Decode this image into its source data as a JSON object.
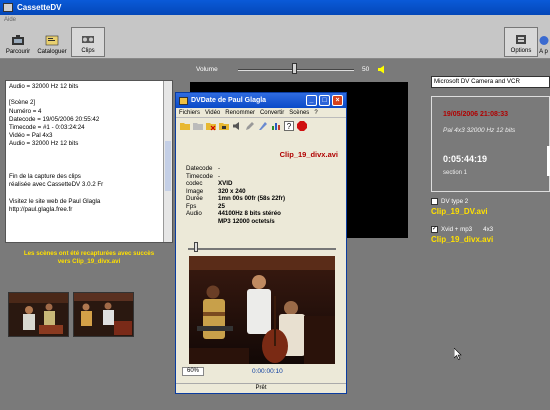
{
  "app": {
    "title": "CassetteDV",
    "menu_item": "Aide"
  },
  "toolbar": {
    "buttons": [
      {
        "label": "Parcourir",
        "icon": "browse-icon"
      },
      {
        "label": "Cataloguer",
        "icon": "catalog-icon"
      },
      {
        "label": "Clips",
        "icon": "clips-icon",
        "active": true
      },
      {
        "label": "Options",
        "icon": "options-icon"
      },
      {
        "label": "A p",
        "icon": "about-icon"
      }
    ]
  },
  "volume": {
    "label": "Volume",
    "value": "50",
    "level": 0.47
  },
  "log": {
    "lines": [
      "Audio = 32000 Hz 12 bits",
      "",
      "[Scène 2]",
      "Numéro = 4",
      "Datecode = 19/05/2006 20:55:42",
      "Timecode = #1 - 0:03:24:24",
      "Vidéo = Pal 4x3",
      "Audio = 32000 Hz 12 bits",
      "",
      "",
      "",
      "Fin de la capture des clips",
      "réalisée avec CassetteDV 3.0.2 Fr",
      "",
      "Visitez le site web de Paul Glagla",
      "http://paul.glagla.free.fr"
    ]
  },
  "success_message": {
    "line1": "Les scènes ont été recapturées avec succès",
    "line2": "vers Clip_19_divx.avi"
  },
  "right_panel": {
    "device": "Microsoft DV Camera and VCR",
    "date": "19/05/2006 21:08:33",
    "format": "Pal 4x3 32000 Hz 12 bits",
    "timecode": "0:05:44:19",
    "section": "section 1",
    "option1_label": "DV type 2",
    "option1_checked": false,
    "option1_file": "Clip_19_DV.avi",
    "option2_label": "Xvid + mp3",
    "option2_extra": "4x3",
    "option2_checked": true,
    "option2_file": "Clip_19_divx.avi"
  },
  "dvdate": {
    "title": "DVDate de Paul Glagla",
    "menu": [
      "Fichiers",
      "Vidéo",
      "Renommer",
      "Convertir",
      "Scènes",
      "?"
    ],
    "filename": "Clip_19_divx.avi",
    "meta": [
      {
        "k": "Datecode",
        "v": "-",
        "bold": false
      },
      {
        "k": "Timecode",
        "v": "-",
        "bold": false
      },
      {
        "k": "codec",
        "v": "XVID",
        "bold": true
      },
      {
        "k": "Image",
        "v": "320 x 240",
        "bold": true
      },
      {
        "k": "Durée",
        "v": "1mn 00s 00fr (58s 22fr)",
        "bold": true
      },
      {
        "k": "Fps",
        "v": "25",
        "bold": true
      },
      {
        "k": "Audio",
        "v": "44100Hz 8 bits  stéréo",
        "bold": true
      },
      {
        "k": "",
        "v": "MP3 12000 octets/s",
        "bold": true
      }
    ],
    "zoom": "60%",
    "time": "0:00:00:10",
    "status": "Prêt"
  },
  "colors": {
    "accent_red": "#b00000",
    "accent_yellow": "#ffe000",
    "title_blue": "#0a4ac8"
  }
}
